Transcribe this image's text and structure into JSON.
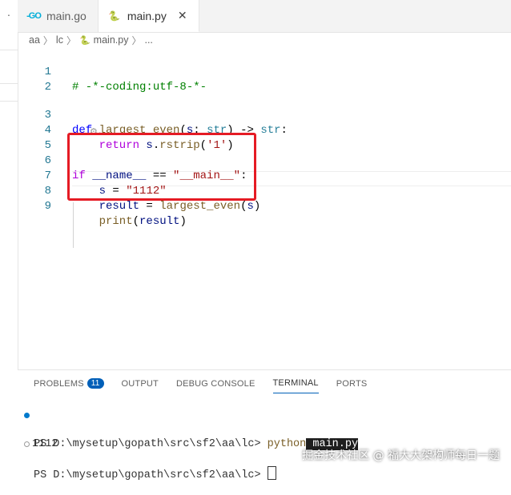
{
  "tabs": [
    {
      "icon": "go-icon",
      "glyph": "-GO",
      "label": "main.go",
      "active": false
    },
    {
      "icon": "python-icon",
      "glyph": "🐍",
      "label": "main.py",
      "active": true,
      "close": "✕"
    }
  ],
  "breadcrumb": [
    "aa",
    "lc",
    "main.py",
    "..."
  ],
  "breadcrumb_sep": "〉",
  "editor": {
    "codelens": "⚙︎⌄",
    "lines": [
      {
        "n": "1",
        "code": "# -*-coding:utf-8-*-"
      },
      {
        "n": "2",
        "code": ""
      },
      {
        "n": "3",
        "code": "def largest_even(s: str) -> str:"
      },
      {
        "n": "4",
        "code": "    return s.rstrip('1')"
      },
      {
        "n": "5",
        "code": ""
      },
      {
        "n": "6",
        "code": "if __name__ == \"__main__\":"
      },
      {
        "n": "7",
        "code": "    s = \"1112\""
      },
      {
        "n": "8",
        "code": "    result = largest_even(s)"
      },
      {
        "n": "9",
        "code": "    print(result)"
      }
    ]
  },
  "panel": {
    "tabs": [
      {
        "label": "PROBLEMS",
        "badge": "11"
      },
      {
        "label": "OUTPUT"
      },
      {
        "label": "DEBUG CONSOLE"
      },
      {
        "label": "TERMINAL",
        "active": true
      },
      {
        "label": "PORTS"
      }
    ],
    "terminal": {
      "prompt1": "PS D:\\mysetup\\gopath\\src\\sf2\\aa\\lc> ",
      "cmd": "python",
      "arg": " main.py",
      "output": "1112",
      "prompt2": "PS D:\\mysetup\\gopath\\src\\sf2\\aa\\lc> "
    }
  },
  "watermark": "掘金技术社区 @ 福大大架构师每日一题",
  "colors": {
    "accent": "#005fb8",
    "highlight_box": "#e51b24",
    "bullet_blue": "#007acc"
  }
}
